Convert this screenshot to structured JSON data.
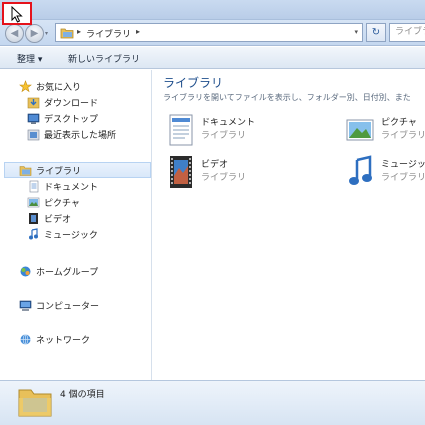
{
  "window": {
    "address": {
      "breadcrumb": "ライブラリ",
      "separator": "▸"
    },
    "search_placeholder": "ライブラリの検索",
    "back_glyph": "◀",
    "forward_glyph": "▶",
    "refresh_glyph": "↻",
    "dropdown_glyph": "▾"
  },
  "toolbar": {
    "organize_label": "整理 ▾",
    "new_library_label": "新しいライブラリ"
  },
  "sidebar": {
    "favorites": {
      "label": "お気に入り",
      "items": [
        {
          "label": "ダウンロード",
          "icon": "download-folder-icon"
        },
        {
          "label": "デスクトップ",
          "icon": "desktop-icon"
        },
        {
          "label": "最近表示した場所",
          "icon": "recent-places-icon"
        }
      ]
    },
    "libraries": {
      "label": "ライブラリ",
      "items": [
        {
          "label": "ドキュメント",
          "icon": "documents-icon"
        },
        {
          "label": "ピクチャ",
          "icon": "pictures-icon"
        },
        {
          "label": "ビデオ",
          "icon": "videos-icon"
        },
        {
          "label": "ミュージック",
          "icon": "music-icon"
        }
      ]
    },
    "homegroup": "ホームグループ",
    "computer": "コンピューター",
    "network": "ネットワーク"
  },
  "main": {
    "title": "ライブラリ",
    "subtitle": "ライブラリを開いてファイルを表示し、フォルダー別、日付別、また",
    "items": [
      {
        "name": "ドキュメント",
        "type": "ライブラリ",
        "icon": "documents-library-icon"
      },
      {
        "name": "ピクチャ",
        "type": "ライブラリ",
        "icon": "pictures-library-icon"
      },
      {
        "name": "ビデオ",
        "type": "ライブラリ",
        "icon": "videos-library-icon"
      },
      {
        "name": "ミュージック",
        "type": "ライブラリ",
        "icon": "music-library-icon"
      }
    ]
  },
  "status": {
    "item_count": "4 個の項目"
  },
  "colors": {
    "accent": "#1e4e8c",
    "highlight": "#e5121b",
    "chrome": "#c9daf0"
  }
}
